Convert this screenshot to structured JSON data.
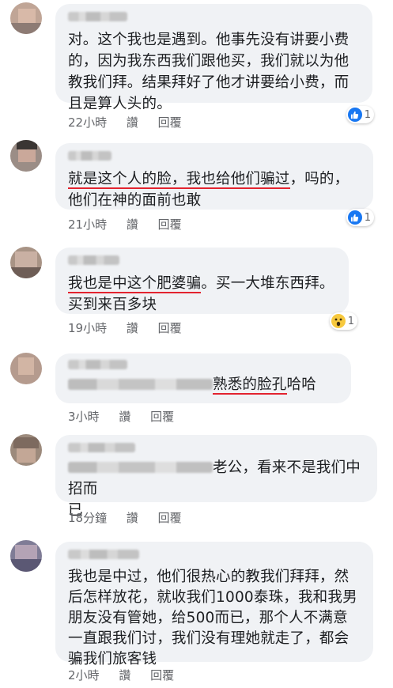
{
  "comments": [
    {
      "text": "对。这个我也是遇到。他事先没有讲要小费的，因为我东西我们跟他买，我们就以为他教我们拜。结果拜好了他才讲要给小费，而且是算人头的。",
      "time": "22小時",
      "like": "讚",
      "reply": "回覆",
      "reaction": {
        "type": "like",
        "count": "1"
      }
    },
    {
      "underlined": "就是这个人的脸，我也给他们骗过",
      "rest": "，吗的，他们在神的面前也敢",
      "time": "21小時",
      "like": "讚",
      "reply": "回覆",
      "reaction": {
        "type": "like",
        "count": "1"
      }
    },
    {
      "underlined": "我也是中这个肥婆骗",
      "rest": "。买一大堆东西拜。买到来百多块",
      "time": "19小時",
      "like": "讚",
      "reply": "回覆",
      "reaction": {
        "type": "wow",
        "count": "1"
      }
    },
    {
      "underlined": "熟悉的脸孔",
      "rest": "哈哈",
      "time": "3小時",
      "like": "讚",
      "reply": "回覆"
    },
    {
      "text_line1": "老公，看来不是我们中招而",
      "text_line2": "已",
      "time": "18分鐘",
      "like": "讚",
      "reply": "回覆"
    },
    {
      "text": "我也是中过，他们很热心的教我们拜拜，然后怎样放花，就收我们1000泰珠，我和我男朋友没有管她，给500而已，那个人不满意一直跟我们讨，我们没有理她就走了，都会骗我们旅客钱",
      "time": "2小時",
      "like": "讚",
      "reply": "回覆"
    }
  ],
  "colors": {
    "underline": "#e3232f",
    "bubble": "#f0f2f5",
    "meta": "#65676b",
    "like": "#1877f2"
  }
}
